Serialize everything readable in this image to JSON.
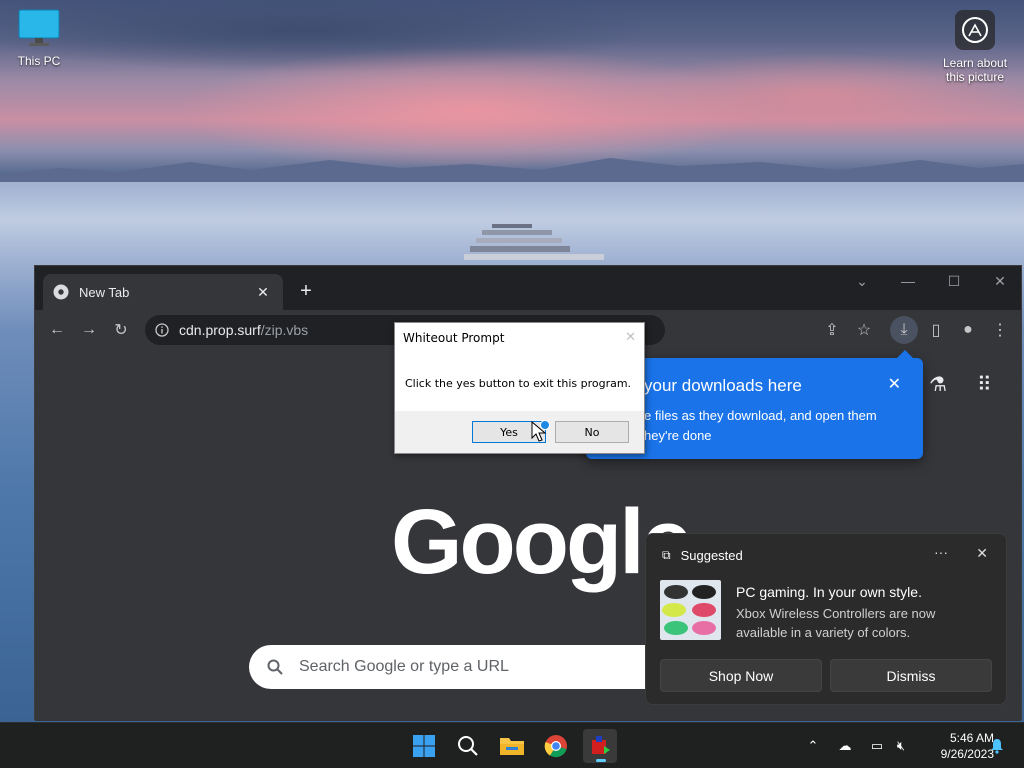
{
  "desktop": {
    "icons": [
      {
        "label": "This PC",
        "icon": "computer-monitor-icon"
      },
      {
        "label": "Learn about this picture",
        "icon": "camera-icon"
      }
    ]
  },
  "browser": {
    "tab": {
      "title": "New Tab",
      "icon": "chrome-icon"
    },
    "address": {
      "domain": "cdn.prop.surf",
      "path": "/zip.vbs",
      "icon": "info-icon"
    },
    "page": {
      "logo": "Google",
      "search_placeholder": "Search Google or type a URL"
    },
    "downloads_bubble": {
      "title": "your downloads here",
      "body": "e files as they download, and open them hey're done"
    }
  },
  "dialog": {
    "title": "Whiteout Prompt",
    "message": "Click the yes button to exit this program.",
    "yes_label": "Yes",
    "no_label": "No"
  },
  "toast": {
    "header": "Suggested",
    "title": "PC gaming. In your own style.",
    "body": "Xbox Wireless Controllers are now available in a variety of colors.",
    "shop_label": "Shop Now",
    "dismiss_label": "Dismiss"
  },
  "taskbar": {
    "apps": [
      "start-icon",
      "search-icon",
      "file-explorer-icon",
      "chrome-icon",
      "running-app-icon"
    ],
    "clock": {
      "time": "5:46 AM",
      "date": "9/26/2023"
    }
  },
  "colors": {
    "accent_blue": "#1a73e8",
    "chrome_dark": "#35363a",
    "taskbar": "#1f2020"
  }
}
